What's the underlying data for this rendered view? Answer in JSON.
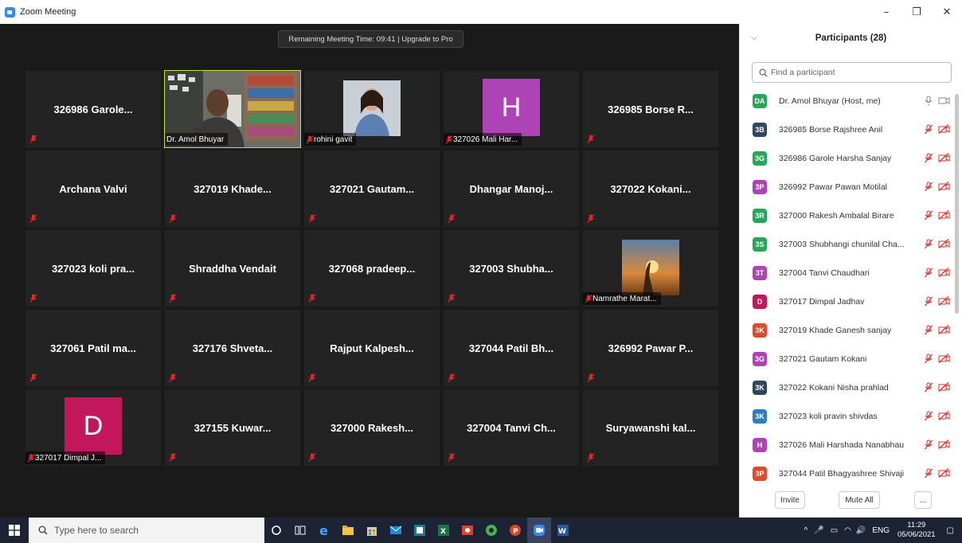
{
  "window": {
    "title": "Zoom Meeting",
    "minimize": "–",
    "restore": "❐",
    "close": "✕"
  },
  "meeting": {
    "banner": "Remaining Meeting Time: 09:41 | Upgrade to Pro"
  },
  "tiles": [
    {
      "kind": "name",
      "name": "326986 Garole...",
      "muted": true
    },
    {
      "kind": "video",
      "label": "Dr. Amol Bhuyar",
      "speaking": true
    },
    {
      "kind": "photo",
      "label": "rohini gavit",
      "muted": true
    },
    {
      "kind": "avatar",
      "letter": "H",
      "color": "#ad43b5",
      "label": "327026 Mali Har...",
      "muted": true
    },
    {
      "kind": "name",
      "name": "326985 Borse R...",
      "muted": true
    },
    {
      "kind": "name",
      "name": "Archana Valvi",
      "muted": true
    },
    {
      "kind": "name",
      "name": "327019  Khade...",
      "muted": true
    },
    {
      "kind": "name",
      "name": "327021 Gautam...",
      "muted": true
    },
    {
      "kind": "name",
      "name": "Dhangar  Manoj...",
      "muted": true
    },
    {
      "kind": "name",
      "name": "327022 Kokani...",
      "muted": true
    },
    {
      "kind": "name",
      "name": "327023 koli pra...",
      "muted": true
    },
    {
      "kind": "name",
      "name": "Shraddha Vendait",
      "muted": true
    },
    {
      "kind": "name",
      "name": "327068 pradeep...",
      "muted": true
    },
    {
      "kind": "name",
      "name": "327003 Shubha...",
      "muted": true
    },
    {
      "kind": "sunset",
      "label": "Namrathe Marat...",
      "muted": true
    },
    {
      "kind": "name",
      "name": "327061 Patil ma...",
      "muted": true
    },
    {
      "kind": "name",
      "name": "327176 Shveta...",
      "muted": true
    },
    {
      "kind": "name",
      "name": "Rajput  Kalpesh...",
      "muted": true
    },
    {
      "kind": "name",
      "name": "327044 Patil Bh...",
      "muted": true
    },
    {
      "kind": "name",
      "name": "326992 Pawar P...",
      "muted": true
    },
    {
      "kind": "avatar",
      "letter": "D",
      "color": "#c2185b",
      "label": "327017 Dimpal J...",
      "muted": true
    },
    {
      "kind": "name",
      "name": "327155 Kuwar...",
      "muted": true
    },
    {
      "kind": "name",
      "name": "327000 Rakesh...",
      "muted": true
    },
    {
      "kind": "name",
      "name": "327004 Tanvi Ch...",
      "muted": true
    },
    {
      "kind": "name",
      "name": "Suryawanshi  kal...",
      "muted": true
    }
  ],
  "panel": {
    "title": "Participants (28)",
    "search_placeholder": "Find a participant",
    "invite": "Invite",
    "mute_all": "Mute All",
    "more": "...",
    "participants": [
      {
        "initials": "DA",
        "color": "#26a85a",
        "name": "Dr. Amol Bhuyar (Host, me)",
        "host": true
      },
      {
        "initials": "3B",
        "color": "#30455e",
        "name": "326985 Borse Rajshree Anil"
      },
      {
        "initials": "3G",
        "color": "#26a85a",
        "name": "326986 Garole Harsha Sanjay"
      },
      {
        "initials": "3P",
        "color": "#ad43b5",
        "name": "326992 Pawar Pawan Motilal"
      },
      {
        "initials": "3R",
        "color": "#26a85a",
        "name": "327000 Rakesh Ambalal Birare"
      },
      {
        "initials": "3S",
        "color": "#26a85a",
        "name": "327003 Shubhangi chunilal Cha..."
      },
      {
        "initials": "3T",
        "color": "#ad43b5",
        "name": "327004 Tanvi Chaudhari"
      },
      {
        "initials": "D",
        "color": "#c2185b",
        "name": "327017 Dimpal Jadhav"
      },
      {
        "initials": "3K",
        "color": "#e0492c",
        "name": "327019  Khade Ganesh sanjay"
      },
      {
        "initials": "3G",
        "color": "#ad43b5",
        "name": "327021 Gautam Kokani"
      },
      {
        "initials": "3K",
        "color": "#30455e",
        "name": "327022 Kokani Nisha prahlad"
      },
      {
        "initials": "3K",
        "color": "#2c7fc4",
        "name": "327023 koli pravin shivdas"
      },
      {
        "initials": "H",
        "color": "#ad43b5",
        "name": "327026 Mali Harshada Nanabhau"
      },
      {
        "initials": "3P",
        "color": "#e0492c",
        "name": "327044 Patil Bhagyashree Shivaji"
      }
    ]
  },
  "taskbar": {
    "search_placeholder": "Type here to search",
    "lang": "ENG",
    "time": "11:29",
    "date": "05/06/2021"
  },
  "colors": {
    "speaking_border": "#c6e03a",
    "mute_red": "#e02828",
    "taskbar": "#1c2335"
  }
}
